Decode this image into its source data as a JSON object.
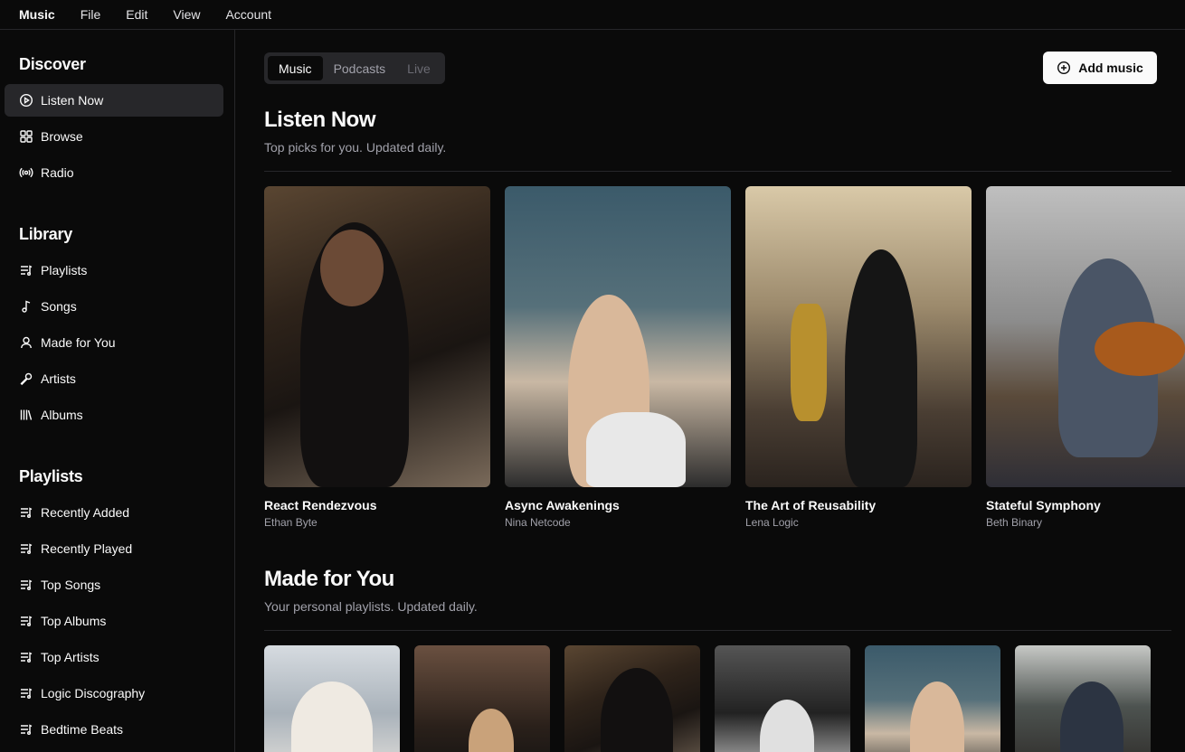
{
  "menubar": {
    "items": [
      "Music",
      "File",
      "Edit",
      "View",
      "Account"
    ]
  },
  "sidebar": {
    "discover": {
      "heading": "Discover",
      "items": [
        {
          "label": "Listen Now",
          "icon": "play-circle-icon",
          "active": true
        },
        {
          "label": "Browse",
          "icon": "grid-icon"
        },
        {
          "label": "Radio",
          "icon": "radio-icon"
        }
      ]
    },
    "library": {
      "heading": "Library",
      "items": [
        {
          "label": "Playlists",
          "icon": "list-music-icon"
        },
        {
          "label": "Songs",
          "icon": "music-note-icon"
        },
        {
          "label": "Made for You",
          "icon": "user-icon"
        },
        {
          "label": "Artists",
          "icon": "mic-icon"
        },
        {
          "label": "Albums",
          "icon": "library-icon"
        }
      ]
    },
    "playlists": {
      "heading": "Playlists",
      "items": [
        {
          "label": "Recently Added",
          "icon": "list-music-icon"
        },
        {
          "label": "Recently Played",
          "icon": "list-music-icon"
        },
        {
          "label": "Top Songs",
          "icon": "list-music-icon"
        },
        {
          "label": "Top Albums",
          "icon": "list-music-icon"
        },
        {
          "label": "Top Artists",
          "icon": "list-music-icon"
        },
        {
          "label": "Logic Discography",
          "icon": "list-music-icon"
        },
        {
          "label": "Bedtime Beats",
          "icon": "list-music-icon"
        }
      ]
    }
  },
  "main": {
    "tabs": [
      {
        "label": "Music",
        "state": "active"
      },
      {
        "label": "Podcasts",
        "state": "normal"
      },
      {
        "label": "Live",
        "state": "disabled"
      }
    ],
    "add_button": "Add music",
    "listen_now": {
      "title": "Listen Now",
      "subtitle": "Top picks for you. Updated daily.",
      "albums": [
        {
          "title": "React Rendezvous",
          "artist": "Ethan Byte"
        },
        {
          "title": "Async Awakenings",
          "artist": "Nina Netcode"
        },
        {
          "title": "The Art of Reusability",
          "artist": "Lena Logic"
        },
        {
          "title": "Stateful Symphony",
          "artist": "Beth Binary"
        }
      ]
    },
    "made_for_you": {
      "title": "Made for You",
      "subtitle": "Your personal playlists. Updated daily.",
      "count": 6
    }
  }
}
